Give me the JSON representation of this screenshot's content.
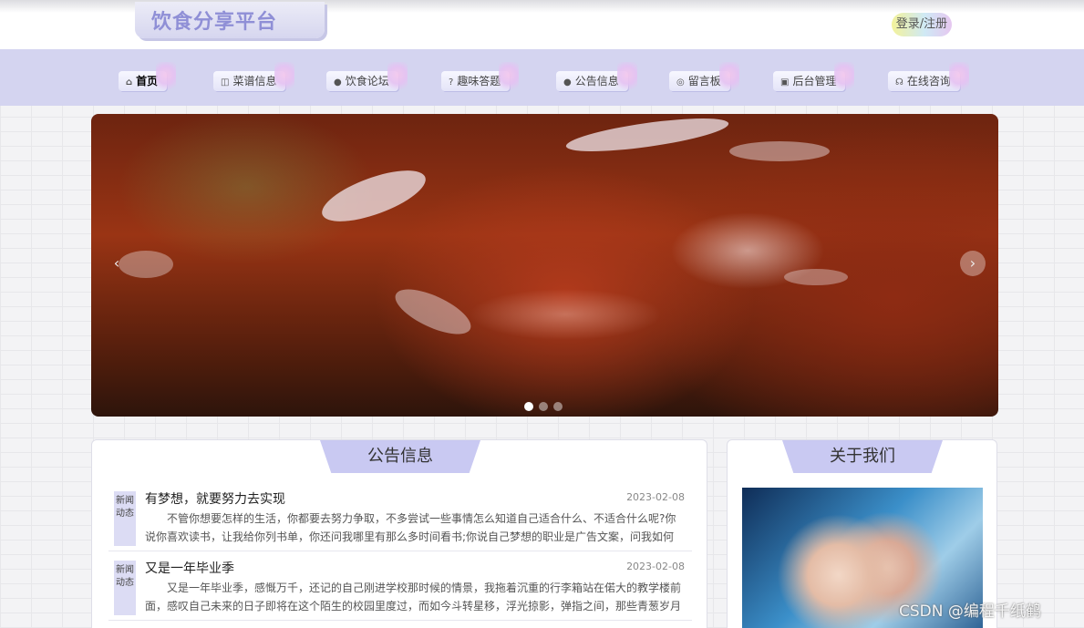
{
  "header": {
    "logo": "饮食分享平台",
    "login_label": "登录/注册"
  },
  "nav": {
    "items": [
      {
        "label": "首页",
        "icon": "home-icon",
        "active": true
      },
      {
        "label": "菜谱信息",
        "icon": "bag-icon"
      },
      {
        "label": "饮食论坛",
        "icon": "info-icon"
      },
      {
        "label": "趣味答题",
        "icon": "question-icon"
      },
      {
        "label": "公告信息",
        "icon": "info-icon"
      },
      {
        "label": "留言板",
        "icon": "message-icon"
      },
      {
        "label": "后台管理",
        "icon": "admin-icon"
      },
      {
        "label": "在线咨询",
        "icon": "headset-icon"
      }
    ]
  },
  "banner": {
    "prev_label": "‹",
    "next_label": "›",
    "slides": 3,
    "active_slide": 1
  },
  "notices": {
    "title": "公告信息",
    "items": [
      {
        "tag": "新闻动态",
        "title": "有梦想，就要努力去实现",
        "date": "2023-02-08",
        "summary": "不管你想要怎样的生活，你都要去努力争取，不多尝试一些事情怎么知道自己适合什么、不适合什么呢?你说你喜欢读书，让我给你列书单，你还问我哪里有那么多时间看书;你说自己梦想的职业是广告文案，问我如何成为一"
      },
      {
        "tag": "新闻动态",
        "title": "又是一年毕业季",
        "date": "2023-02-08",
        "summary": "又是一年毕业季，感慨万千，还记的自己刚进学校那时候的情景，我拖着沉重的行李箱站在偌大的教学楼前面，感叹自己未来的日子即将在这个陌生的校园里度过，而如今斗转星移，浮光掠影，弹指之间，那些青葱岁月如"
      }
    ]
  },
  "about": {
    "title": "关于我们"
  },
  "watermark": "CSDN @编程千纸鹤"
}
